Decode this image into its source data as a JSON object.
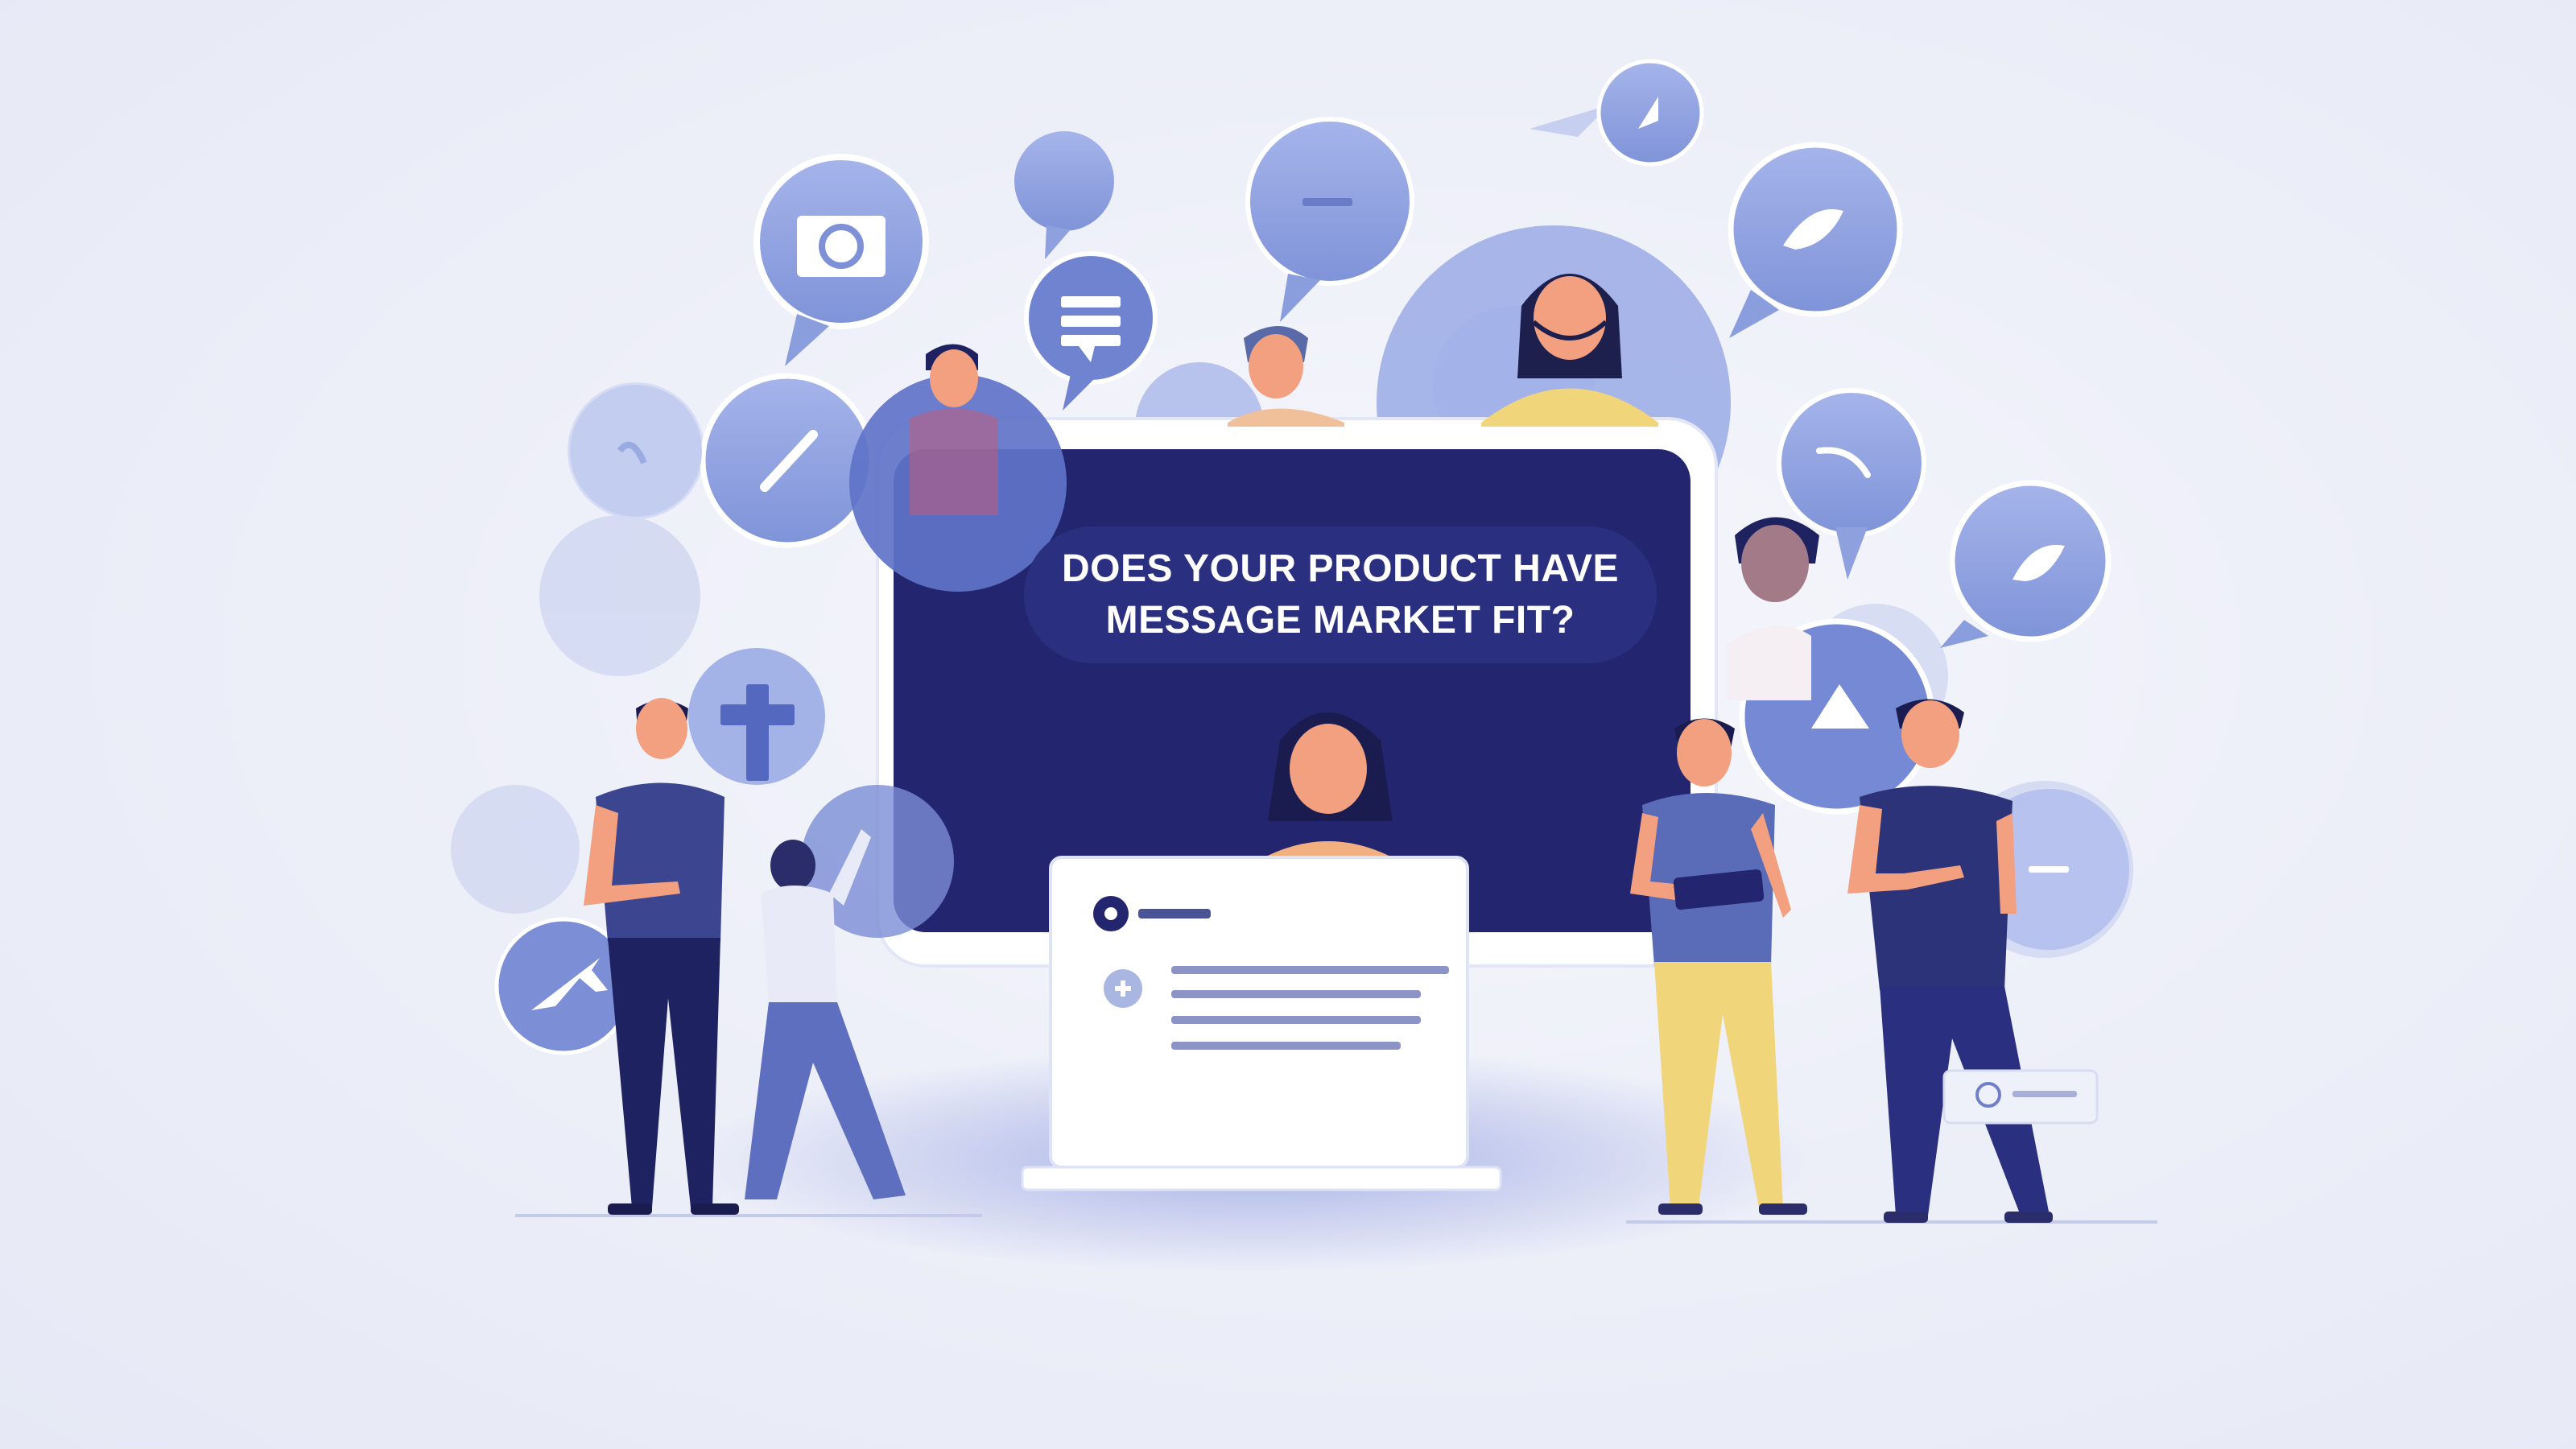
{
  "headline": {
    "line1": "DOES YOUR PRODUCT HAVE",
    "line2": "MESSAGE MARKET FIT?"
  },
  "colors": {
    "background": "#eef0f8",
    "screen_navy": "#23266e",
    "bubble_blue": "#8fa2e0",
    "figure_navy": "#232870",
    "skin": "#f2a080",
    "yellow": "#f1d57a",
    "white": "#ffffff"
  },
  "icons": [
    "camera-icon",
    "chat-icon",
    "minus-icon",
    "leaf-icon",
    "pencil-icon",
    "cross-icon",
    "plane-icon",
    "triangle-icon",
    "plus-icon"
  ]
}
